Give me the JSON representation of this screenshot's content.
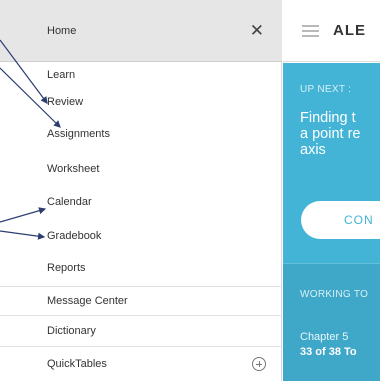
{
  "sidebar": {
    "items": [
      {
        "label": "Home"
      },
      {
        "label": "Learn"
      },
      {
        "label": "Review"
      },
      {
        "label": "Assignments"
      },
      {
        "label": "Worksheet"
      },
      {
        "label": "Calendar"
      },
      {
        "label": "Gradebook"
      },
      {
        "label": "Reports"
      },
      {
        "label": "Message Center"
      },
      {
        "label": "Dictionary"
      },
      {
        "label": "QuickTables"
      }
    ],
    "close_icon": "close-icon",
    "expand_icon": "plus-circle-icon"
  },
  "main": {
    "brand": "ALE",
    "up_next_label": "UP NEXT :",
    "topic_title": "Finding t a point re axis",
    "topic_line1": "Finding t",
    "topic_line2": "a point re",
    "topic_line3": "axis",
    "continue_label": "CON",
    "working_label": "WORKING TO",
    "chapter": "Chapter 5",
    "progress": "33 of 38 To"
  },
  "colors": {
    "accent": "#43b3d6",
    "highlight_row": "#e6e6e6",
    "annotation": "#2c3e70"
  }
}
